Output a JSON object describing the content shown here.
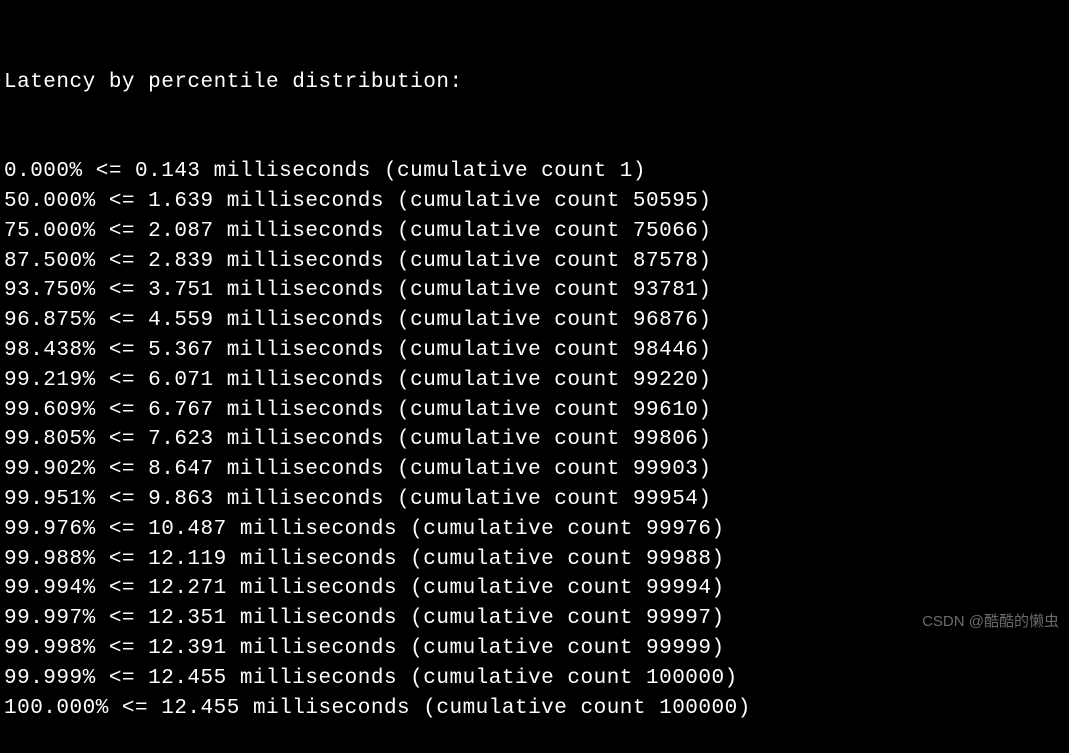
{
  "header": "Latency by percentile distribution:",
  "rows": [
    {
      "percentile": "0.000%",
      "latency": "0.143",
      "count": "1"
    },
    {
      "percentile": "50.000%",
      "latency": "1.639",
      "count": "50595"
    },
    {
      "percentile": "75.000%",
      "latency": "2.087",
      "count": "75066"
    },
    {
      "percentile": "87.500%",
      "latency": "2.839",
      "count": "87578"
    },
    {
      "percentile": "93.750%",
      "latency": "3.751",
      "count": "93781"
    },
    {
      "percentile": "96.875%",
      "latency": "4.559",
      "count": "96876"
    },
    {
      "percentile": "98.438%",
      "latency": "5.367",
      "count": "98446"
    },
    {
      "percentile": "99.219%",
      "latency": "6.071",
      "count": "99220"
    },
    {
      "percentile": "99.609%",
      "latency": "6.767",
      "count": "99610"
    },
    {
      "percentile": "99.805%",
      "latency": "7.623",
      "count": "99806"
    },
    {
      "percentile": "99.902%",
      "latency": "8.647",
      "count": "99903"
    },
    {
      "percentile": "99.951%",
      "latency": "9.863",
      "count": "99954"
    },
    {
      "percentile": "99.976%",
      "latency": "10.487",
      "count": "99976"
    },
    {
      "percentile": "99.988%",
      "latency": "12.119",
      "count": "99988"
    },
    {
      "percentile": "99.994%",
      "latency": "12.271",
      "count": "99994"
    },
    {
      "percentile": "99.997%",
      "latency": "12.351",
      "count": "99997"
    },
    {
      "percentile": "99.998%",
      "latency": "12.391",
      "count": "99999"
    },
    {
      "percentile": "99.999%",
      "latency": "12.455",
      "count": "100000"
    },
    {
      "percentile": "100.000%",
      "latency": "12.455",
      "count": "100000"
    }
  ],
  "watermark": "CSDN @酷酷的懒虫"
}
